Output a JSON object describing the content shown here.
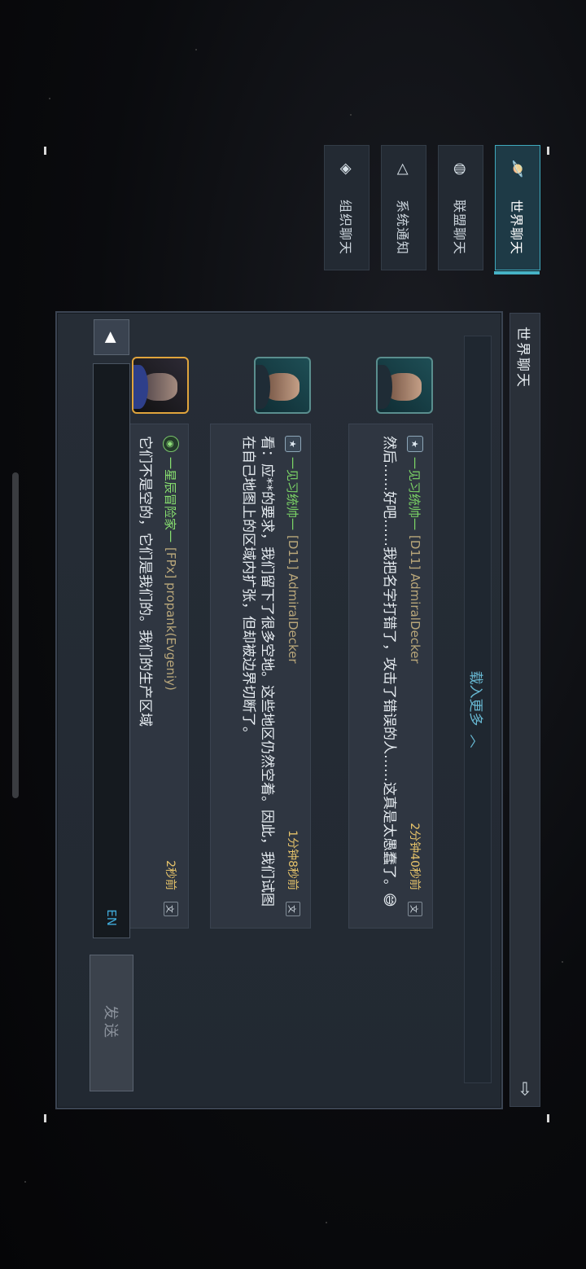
{
  "tabs": [
    {
      "label": "世界聊天",
      "icon": "planet-icon",
      "active": true
    },
    {
      "label": "联盟聊天",
      "icon": "globe-icon",
      "active": false
    },
    {
      "label": "系统通知",
      "icon": "speaker-icon",
      "active": false
    },
    {
      "label": "组织聊天",
      "icon": "diamond-link-icon",
      "active": false
    }
  ],
  "header": {
    "title": "世界聊天"
  },
  "load_more": "载入更多",
  "messages": [
    {
      "rank": "一见习统帅一",
      "name": "[D11] AdmiralDecker",
      "time": "2分钟40秒前",
      "text": "然后……好吧……我把名字打错了，攻击了错误的人……这真是太愚蠢了。😅"
    },
    {
      "rank": "一见习统帅一",
      "name": "[D11] AdmiralDecker",
      "time": "1分钟8秒前",
      "text": "看：应**的要求，我们留下了很多空地。这些地区仍然空着。因此，我们试图在自己地图上的区域内扩张，但却被边界切断了。"
    },
    {
      "rank": "一星辰冒险家一",
      "name": "[FPx] propank(Evgeniy)",
      "time": "2秒前",
      "text": "它们不是空的，它们是我们的。我们的生产区域"
    }
  ],
  "input": {
    "language": "EN"
  },
  "send_label": "发送",
  "colors": {
    "accent": "#46b3c6",
    "rank_green": "#7bd466",
    "time_gold": "#e6c36a"
  }
}
